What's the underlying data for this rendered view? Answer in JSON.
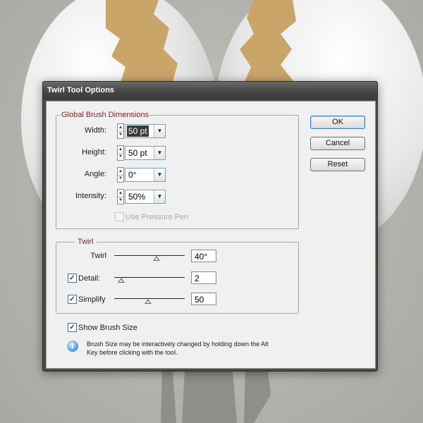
{
  "dialog": {
    "title": "Twirl Tool Options",
    "brush_group": {
      "legend": "Global Brush Dimensions",
      "width": {
        "label": "Width:",
        "value": "50 pt"
      },
      "height": {
        "label": "Height:",
        "value": "50 pt"
      },
      "angle": {
        "label": "Angle:",
        "value": "0°"
      },
      "intensity": {
        "label": "Intensity:",
        "value": "50%"
      },
      "use_pressure_pen": {
        "label": "Use Pressure Pen",
        "checked": false,
        "enabled": false
      }
    },
    "twirl_group": {
      "legend": "Twirl",
      "twirl": {
        "label": "Twirl",
        "value": "40°",
        "slider_fraction": 0.6
      },
      "detail": {
        "label": "Detail:",
        "value": "2",
        "checked": true,
        "slider_fraction": 0.1
      },
      "simplify": {
        "label": "Simplify",
        "value": "50",
        "checked": true,
        "slider_fraction": 0.48
      }
    },
    "show_brush_size": {
      "label": "Show Brush Size",
      "checked": true
    },
    "info": {
      "line1": "Brush Size may be interactively changed by holding down the Alt",
      "line2": "Key before clicking with the tool."
    },
    "buttons": {
      "ok": "OK",
      "cancel": "Cancel",
      "reset": "Reset"
    }
  },
  "colors": {
    "legend_text": "#8b1c1c",
    "accent_blue": "#3c7fb1",
    "background_gold": "#c9a56a",
    "egg_white": "#e9e9e9"
  },
  "icons": {
    "info": "info-icon",
    "check": "check-icon",
    "spin": "spin-arrows-icon",
    "dropdown": "dropdown-arrow-icon"
  }
}
